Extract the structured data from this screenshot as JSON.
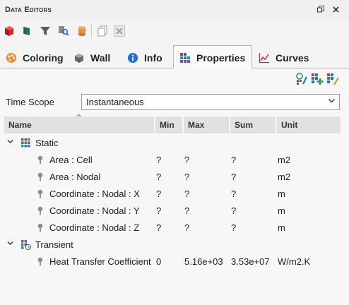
{
  "window": {
    "title": "Data Editors",
    "restore_icon": "restore-window-icon",
    "close_icon": "close-icon"
  },
  "toolbar": {
    "buttons": [
      "cube-icon",
      "flag-icon",
      "filter-icon",
      "search-icon",
      "cylinder-icon",
      "copy-icon",
      "delete-icon"
    ]
  },
  "tabs": [
    {
      "label": "Coloring",
      "icon": "palette-icon"
    },
    {
      "label": "Wall",
      "icon": "wall-icon"
    },
    {
      "label": "Info",
      "icon": "info-icon"
    },
    {
      "label": "Properties",
      "icon": "grid-icon",
      "active": true
    },
    {
      "label": "Curves",
      "icon": "chart-icon"
    }
  ],
  "actions": [
    "property-settings-icon",
    "add-property-icon",
    "edit-properties-icon"
  ],
  "time_scope": {
    "label": "Time Scope",
    "value": "Instantaneous"
  },
  "table": {
    "columns": [
      "Name",
      "Min",
      "Max",
      "Sum",
      "Unit"
    ],
    "groups": [
      {
        "name": "Static",
        "expanded": true,
        "rows": [
          {
            "name": "Area : Cell",
            "min": "?",
            "max": "?",
            "sum": "?",
            "unit": "m2"
          },
          {
            "name": "Area : Nodal",
            "min": "?",
            "max": "?",
            "sum": "?",
            "unit": "m2"
          },
          {
            "name": "Coordinate : Nodal : X",
            "min": "?",
            "max": "?",
            "sum": "?",
            "unit": "m"
          },
          {
            "name": "Coordinate : Nodal : Y",
            "min": "?",
            "max": "?",
            "sum": "?",
            "unit": "m"
          },
          {
            "name": "Coordinate : Nodal : Z",
            "min": "?",
            "max": "?",
            "sum": "?",
            "unit": "m"
          }
        ]
      },
      {
        "name": "Transient",
        "expanded": true,
        "rows": [
          {
            "name": "Heat Transfer Coefficient",
            "min": "0",
            "max": "5.16e+03",
            "sum": "3.53e+07",
            "unit": "W/m2.K"
          }
        ]
      }
    ]
  },
  "colors": {
    "accent_blue": "#1e6fd9",
    "header_bg": "#e1e1e1",
    "panel_bg": "#f7f7f7"
  }
}
